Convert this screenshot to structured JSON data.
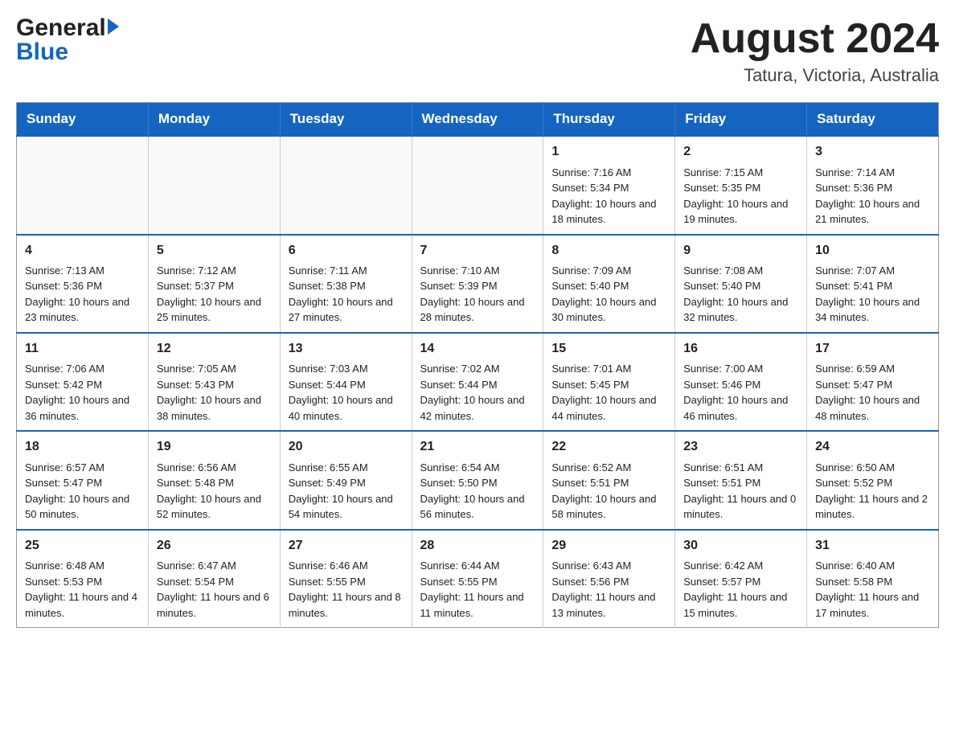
{
  "header": {
    "logo_general": "General",
    "logo_blue": "Blue",
    "month_title": "August 2024",
    "location": "Tatura, Victoria, Australia"
  },
  "calendar": {
    "days_of_week": [
      "Sunday",
      "Monday",
      "Tuesday",
      "Wednesday",
      "Thursday",
      "Friday",
      "Saturday"
    ],
    "weeks": [
      {
        "days": [
          {
            "number": "",
            "info": ""
          },
          {
            "number": "",
            "info": ""
          },
          {
            "number": "",
            "info": ""
          },
          {
            "number": "",
            "info": ""
          },
          {
            "number": "1",
            "info": "Sunrise: 7:16 AM\nSunset: 5:34 PM\nDaylight: 10 hours and 18 minutes."
          },
          {
            "number": "2",
            "info": "Sunrise: 7:15 AM\nSunset: 5:35 PM\nDaylight: 10 hours and 19 minutes."
          },
          {
            "number": "3",
            "info": "Sunrise: 7:14 AM\nSunset: 5:36 PM\nDaylight: 10 hours and 21 minutes."
          }
        ]
      },
      {
        "days": [
          {
            "number": "4",
            "info": "Sunrise: 7:13 AM\nSunset: 5:36 PM\nDaylight: 10 hours and 23 minutes."
          },
          {
            "number": "5",
            "info": "Sunrise: 7:12 AM\nSunset: 5:37 PM\nDaylight: 10 hours and 25 minutes."
          },
          {
            "number": "6",
            "info": "Sunrise: 7:11 AM\nSunset: 5:38 PM\nDaylight: 10 hours and 27 minutes."
          },
          {
            "number": "7",
            "info": "Sunrise: 7:10 AM\nSunset: 5:39 PM\nDaylight: 10 hours and 28 minutes."
          },
          {
            "number": "8",
            "info": "Sunrise: 7:09 AM\nSunset: 5:40 PM\nDaylight: 10 hours and 30 minutes."
          },
          {
            "number": "9",
            "info": "Sunrise: 7:08 AM\nSunset: 5:40 PM\nDaylight: 10 hours and 32 minutes."
          },
          {
            "number": "10",
            "info": "Sunrise: 7:07 AM\nSunset: 5:41 PM\nDaylight: 10 hours and 34 minutes."
          }
        ]
      },
      {
        "days": [
          {
            "number": "11",
            "info": "Sunrise: 7:06 AM\nSunset: 5:42 PM\nDaylight: 10 hours and 36 minutes."
          },
          {
            "number": "12",
            "info": "Sunrise: 7:05 AM\nSunset: 5:43 PM\nDaylight: 10 hours and 38 minutes."
          },
          {
            "number": "13",
            "info": "Sunrise: 7:03 AM\nSunset: 5:44 PM\nDaylight: 10 hours and 40 minutes."
          },
          {
            "number": "14",
            "info": "Sunrise: 7:02 AM\nSunset: 5:44 PM\nDaylight: 10 hours and 42 minutes."
          },
          {
            "number": "15",
            "info": "Sunrise: 7:01 AM\nSunset: 5:45 PM\nDaylight: 10 hours and 44 minutes."
          },
          {
            "number": "16",
            "info": "Sunrise: 7:00 AM\nSunset: 5:46 PM\nDaylight: 10 hours and 46 minutes."
          },
          {
            "number": "17",
            "info": "Sunrise: 6:59 AM\nSunset: 5:47 PM\nDaylight: 10 hours and 48 minutes."
          }
        ]
      },
      {
        "days": [
          {
            "number": "18",
            "info": "Sunrise: 6:57 AM\nSunset: 5:47 PM\nDaylight: 10 hours and 50 minutes."
          },
          {
            "number": "19",
            "info": "Sunrise: 6:56 AM\nSunset: 5:48 PM\nDaylight: 10 hours and 52 minutes."
          },
          {
            "number": "20",
            "info": "Sunrise: 6:55 AM\nSunset: 5:49 PM\nDaylight: 10 hours and 54 minutes."
          },
          {
            "number": "21",
            "info": "Sunrise: 6:54 AM\nSunset: 5:50 PM\nDaylight: 10 hours and 56 minutes."
          },
          {
            "number": "22",
            "info": "Sunrise: 6:52 AM\nSunset: 5:51 PM\nDaylight: 10 hours and 58 minutes."
          },
          {
            "number": "23",
            "info": "Sunrise: 6:51 AM\nSunset: 5:51 PM\nDaylight: 11 hours and 0 minutes."
          },
          {
            "number": "24",
            "info": "Sunrise: 6:50 AM\nSunset: 5:52 PM\nDaylight: 11 hours and 2 minutes."
          }
        ]
      },
      {
        "days": [
          {
            "number": "25",
            "info": "Sunrise: 6:48 AM\nSunset: 5:53 PM\nDaylight: 11 hours and 4 minutes."
          },
          {
            "number": "26",
            "info": "Sunrise: 6:47 AM\nSunset: 5:54 PM\nDaylight: 11 hours and 6 minutes."
          },
          {
            "number": "27",
            "info": "Sunrise: 6:46 AM\nSunset: 5:55 PM\nDaylight: 11 hours and 8 minutes."
          },
          {
            "number": "28",
            "info": "Sunrise: 6:44 AM\nSunset: 5:55 PM\nDaylight: 11 hours and 11 minutes."
          },
          {
            "number": "29",
            "info": "Sunrise: 6:43 AM\nSunset: 5:56 PM\nDaylight: 11 hours and 13 minutes."
          },
          {
            "number": "30",
            "info": "Sunrise: 6:42 AM\nSunset: 5:57 PM\nDaylight: 11 hours and 15 minutes."
          },
          {
            "number": "31",
            "info": "Sunrise: 6:40 AM\nSunset: 5:58 PM\nDaylight: 11 hours and 17 minutes."
          }
        ]
      }
    ]
  }
}
